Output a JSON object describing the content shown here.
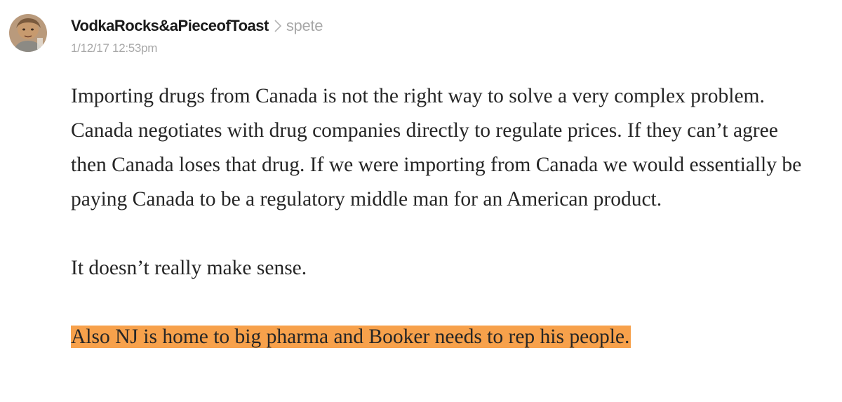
{
  "comment": {
    "avatar_icon": "user-avatar-photo",
    "author": "VodkaRocks&aPieceofToast",
    "separator_icon": "chevron-right-icon",
    "reply_to": "spete",
    "timestamp": "1/12/17 12:53pm",
    "paragraphs": [
      "Importing drugs from Canada is not the right way to solve a very complex problem. Canada negotiates with drug companies directly to regulate prices. If they can’t agree then Canada loses that drug. If we were importing from Canada we would essentially be paying Canada to be a regulatory middle man for an American product.",
      "It doesn’t really make sense.",
      "Also NJ is home to big pharma and Booker needs to rep his people."
    ],
    "highlight_color": "#f7a14b"
  }
}
